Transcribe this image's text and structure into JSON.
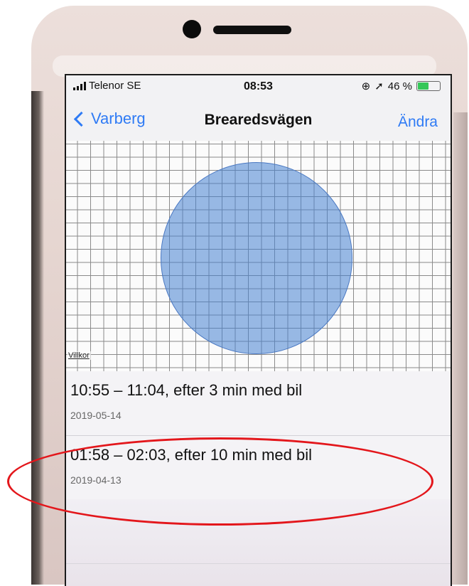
{
  "status_bar": {
    "carrier": "Telenor SE",
    "time": "08:53",
    "battery_percent": "46 %",
    "battery_level": 0.46
  },
  "nav": {
    "back_label": "Varberg",
    "title": "Brearedsvägen",
    "edit_label": "Ändra"
  },
  "map": {
    "terms_link": "Villkor"
  },
  "visits": [
    {
      "title": "10:55 – 11:04, efter 3 min med bil",
      "date": "2019-05-14"
    },
    {
      "title": "01:58 – 02:03, efter 10 min med bil",
      "date": "2019-04-13"
    }
  ],
  "colors": {
    "accent": "#2f7bf5",
    "annotation": "#e3161b",
    "region_fill": "#4682d2"
  }
}
